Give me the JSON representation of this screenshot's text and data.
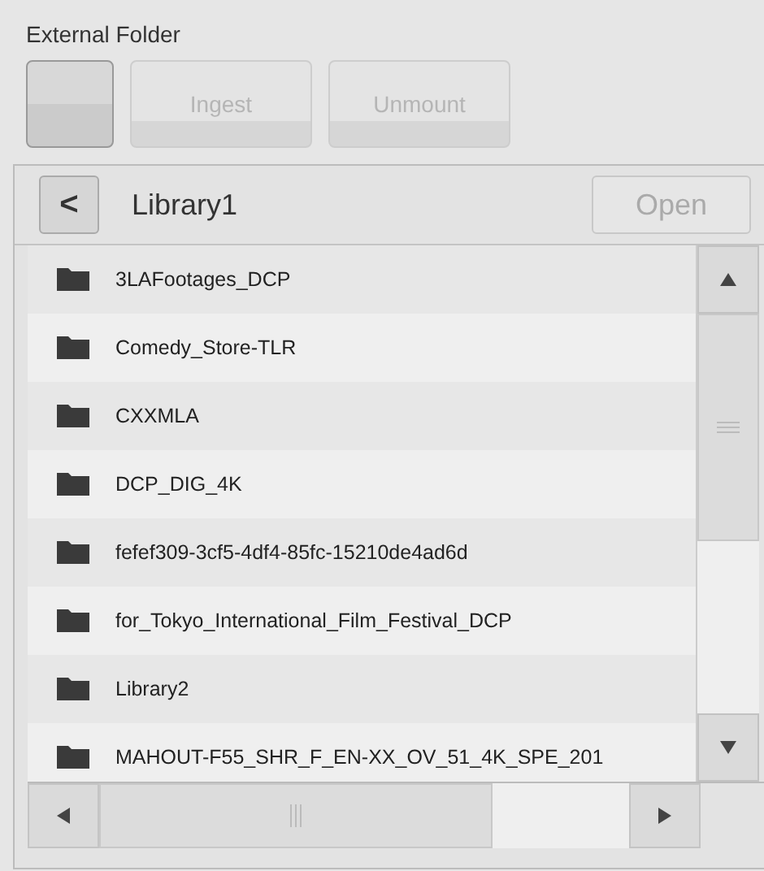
{
  "section_title": "External Folder",
  "buttons": [
    {
      "disabled": false
    },
    {
      "label": "Ingest",
      "disabled": true
    },
    {
      "label": "Unmount",
      "disabled": true
    }
  ],
  "browser": {
    "back": "<",
    "path": "Library1",
    "open_button": {
      "label": "Open",
      "disabled": true
    },
    "folders": [
      {
        "name": "3LAFootages_DCP"
      },
      {
        "name": "Comedy_Store-TLR"
      },
      {
        "name": "CXXMLA"
      },
      {
        "name": "DCP_DIG_4K"
      },
      {
        "name": "fefef309-3cf5-4df4-85fc-15210de4ad6d"
      },
      {
        "name": "for_Tokyo_International_Film_Festival_DCP"
      },
      {
        "name": "Library2"
      },
      {
        "name": "MAHOUT-F55_SHR_F_EN-XX_OV_51_4K_SPE_201"
      }
    ]
  }
}
